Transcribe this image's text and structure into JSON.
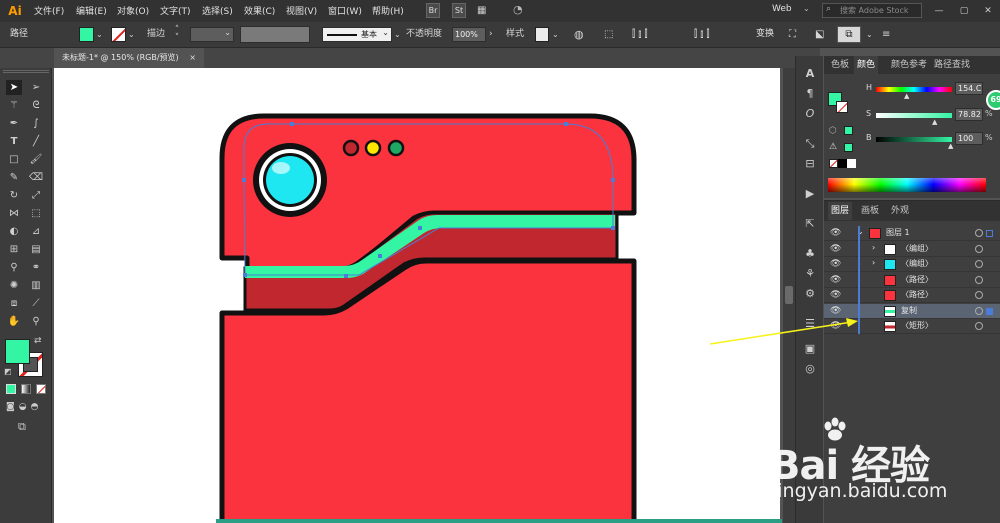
{
  "app": {
    "logo": "Ai"
  },
  "menu": [
    "文件(F)",
    "编辑(E)",
    "对象(O)",
    "文字(T)",
    "选择(S)",
    "效果(C)",
    "视图(V)",
    "窗口(W)",
    "帮助(H)"
  ],
  "app_buttons": {
    "br": "Br",
    "st": "St"
  },
  "workspace": {
    "label": "Web"
  },
  "search": {
    "placeholder": "搜索 Adobe Stock"
  },
  "control_bar": {
    "object_type": "路径",
    "stroke_label": "描边",
    "stroke_style": "基本",
    "opacity_label": "不透明度",
    "opacity_value": "100%",
    "style_label": "样式",
    "transform_label": "变换"
  },
  "document": {
    "tab_title": "未标题-1* @ 150% (RGB/预览)",
    "close": "×"
  },
  "color_panel": {
    "tabs": [
      "色板",
      "颜色",
      "颜色参考",
      "路径查找"
    ],
    "active_tab": "颜色",
    "h_label": "H",
    "h_value": "154.C",
    "s_label": "S",
    "s_value": "78.82",
    "b_label": "B",
    "b_value": "100",
    "pct": "%",
    "badge": "69",
    "fill_color": "#33f5a3"
  },
  "layers_panel": {
    "tabs": [
      "图层",
      "画板",
      "外观"
    ],
    "rows": [
      {
        "name": "图层 1",
        "indent": 0,
        "expand": "⌄",
        "selected": false
      },
      {
        "name": "〈编组〉",
        "indent": 1,
        "expand": "›",
        "selected": false
      },
      {
        "name": "〈编组〉",
        "indent": 1,
        "expand": "›",
        "selected": false
      },
      {
        "name": "〈路径〉",
        "indent": 1,
        "expand": "",
        "selected": false
      },
      {
        "name": "〈路径〉",
        "indent": 1,
        "expand": "",
        "selected": false
      },
      {
        "name": "复制",
        "indent": 1,
        "expand": "",
        "selected": true
      },
      {
        "name": "〈矩形〉",
        "indent": 1,
        "expand": "",
        "selected": false
      }
    ]
  },
  "watermark": {
    "brand": "Bai 经验",
    "url": "jingyan.baidu.com"
  },
  "colors": {
    "device_red": "#fb333f",
    "device_dark_red": "#c1272e",
    "accent_green": "#33f5a3",
    "lens_cyan": "#1ee7f2"
  }
}
